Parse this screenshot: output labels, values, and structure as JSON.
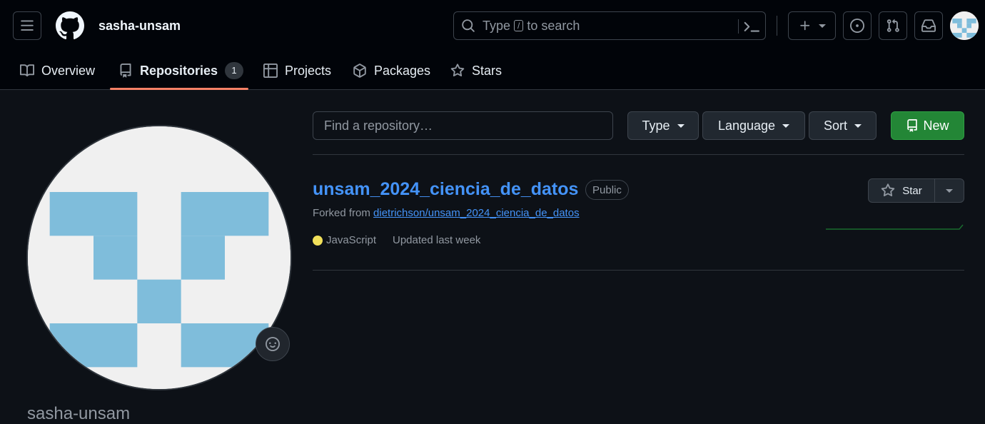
{
  "header": {
    "username": "sasha-unsam",
    "search": {
      "before_key": "Type",
      "key": "/",
      "after_key": "to search"
    }
  },
  "tabs": [
    {
      "label": "Overview"
    },
    {
      "label": "Repositories",
      "count": "1"
    },
    {
      "label": "Projects"
    },
    {
      "label": "Packages"
    },
    {
      "label": "Stars"
    }
  ],
  "profile": {
    "name": "sasha-unsam"
  },
  "filters": {
    "find_placeholder": "Find a repository…",
    "type": "Type",
    "language": "Language",
    "sort": "Sort",
    "new": "New"
  },
  "repo": {
    "name": "unsam_2024_ciencia_de_datos",
    "visibility": "Public",
    "forked_prefix": "Forked from",
    "forked_from": "dietrichson/unsam_2024_ciencia_de_datos",
    "language": "JavaScript",
    "language_color": "#f1e05a",
    "updated": "Updated last week",
    "star_label": "Star"
  },
  "colors": {
    "accent": "#4493f8",
    "tab_underline": "#f78166",
    "new_button": "#238636",
    "identicon": "#7fbddb"
  }
}
